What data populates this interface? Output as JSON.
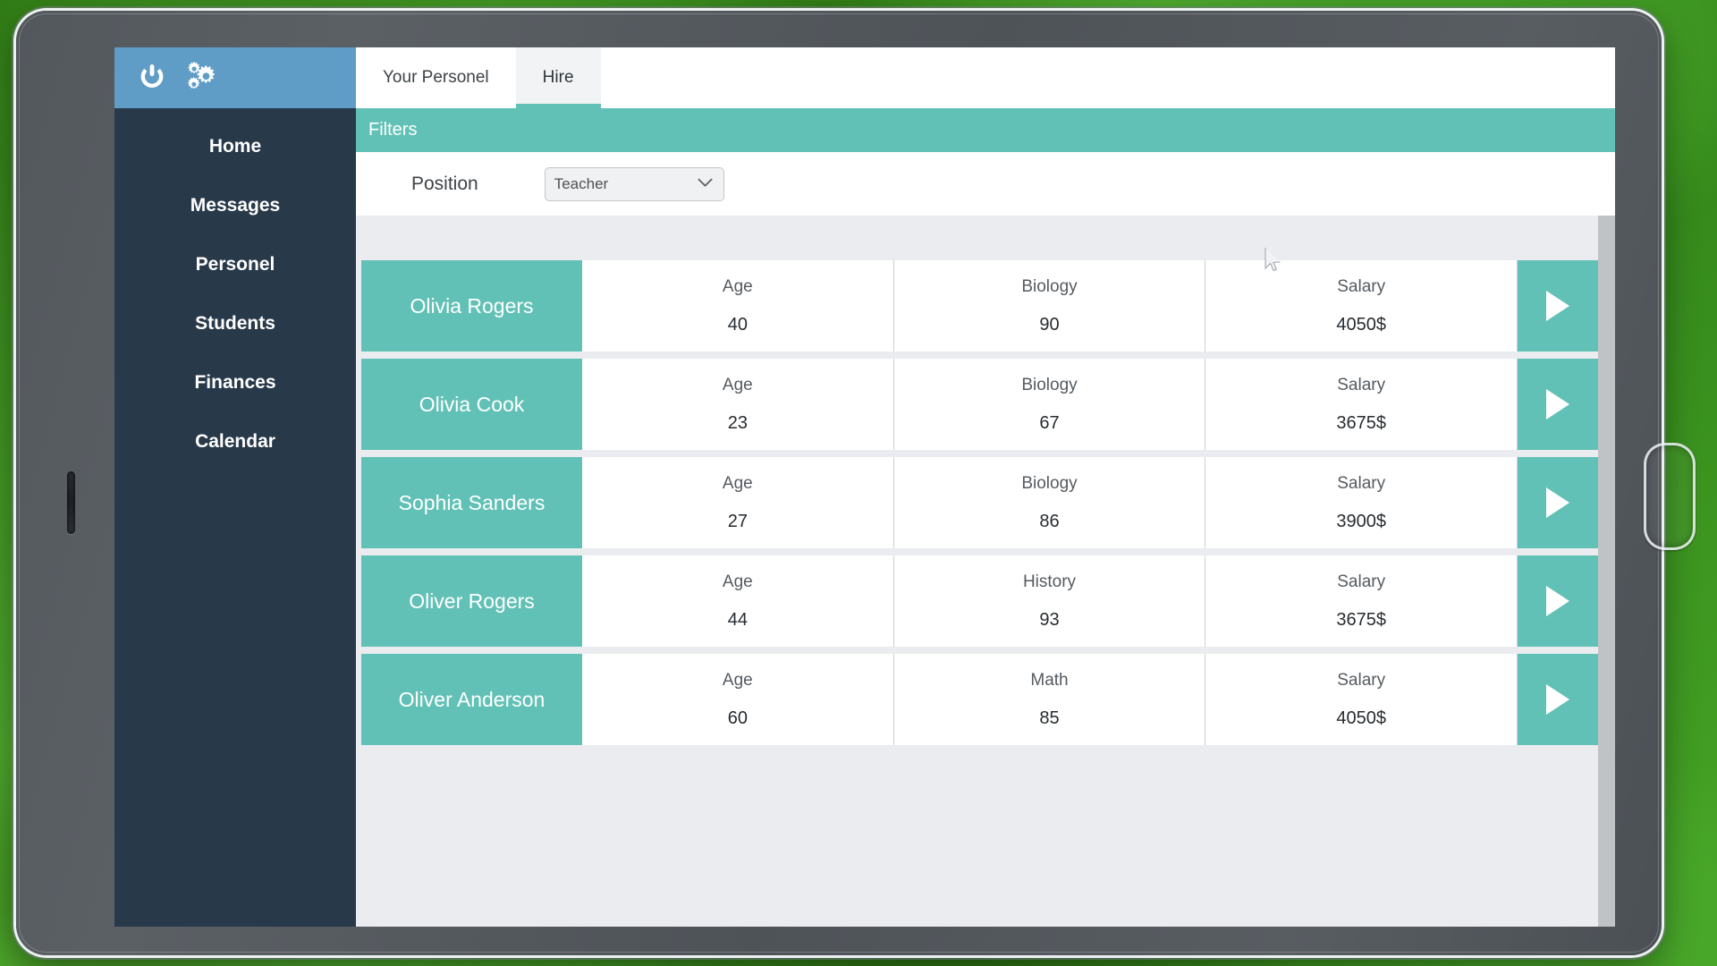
{
  "device": {
    "home_button": "home-button",
    "speaker_slot": "speaker-slot"
  },
  "logo_bar": {
    "power_icon": "power-icon",
    "gears_icon": "gears-icon",
    "background_color": "#5f9dc7"
  },
  "tabs": [
    {
      "label": "Your Personel",
      "active": false
    },
    {
      "label": "Hire",
      "active": true
    }
  ],
  "sidebar": {
    "background_color": "#28394a",
    "items": [
      {
        "label": "Home"
      },
      {
        "label": "Messages"
      },
      {
        "label": "Personel"
      },
      {
        "label": "Students"
      },
      {
        "label": "Finances"
      },
      {
        "label": "Calendar"
      }
    ]
  },
  "filters": {
    "title": "Filters",
    "accent_color": "#62c1b6",
    "position": {
      "label": "Position",
      "value": "Teacher",
      "options": [
        "Teacher"
      ],
      "chevron_icon": "chevron-down-icon"
    }
  },
  "table": {
    "row_accent_color": "#62c1b6",
    "action_icon": "play-icon",
    "rows": [
      {
        "name": "Olivia Rogers",
        "age_label": "Age",
        "age_value": "40",
        "subject_label": "Biology",
        "subject_value": "90",
        "salary_label": "Salary",
        "salary_value": "4050$"
      },
      {
        "name": "Olivia Cook",
        "age_label": "Age",
        "age_value": "23",
        "subject_label": "Biology",
        "subject_value": "67",
        "salary_label": "Salary",
        "salary_value": "3675$"
      },
      {
        "name": "Sophia Sanders",
        "age_label": "Age",
        "age_value": "27",
        "subject_label": "Biology",
        "subject_value": "86",
        "salary_label": "Salary",
        "salary_value": "3900$"
      },
      {
        "name": "Oliver Rogers",
        "age_label": "Age",
        "age_value": "44",
        "subject_label": "History",
        "subject_value": "93",
        "salary_label": "Salary",
        "salary_value": "3675$"
      },
      {
        "name": "Oliver Anderson",
        "age_label": "Age",
        "age_value": "60",
        "subject_label": "Math",
        "subject_value": "85",
        "salary_label": "Salary",
        "salary_value": "4050$"
      }
    ]
  },
  "pointer": {
    "icon": "mouse-cursor"
  }
}
